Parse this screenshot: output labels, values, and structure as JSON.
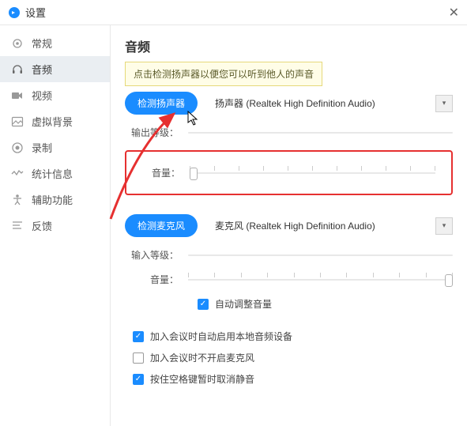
{
  "titlebar": {
    "title": "设置"
  },
  "sidebar": {
    "items": [
      {
        "label": "常规"
      },
      {
        "label": "音频"
      },
      {
        "label": "视频"
      },
      {
        "label": "虚拟背景"
      },
      {
        "label": "录制"
      },
      {
        "label": "统计信息"
      },
      {
        "label": "辅助功能"
      },
      {
        "label": "反馈"
      }
    ]
  },
  "page": {
    "title": "音频",
    "tooltip": "点击检测扬声器以便您可以听到他人的声音",
    "speaker": {
      "test_btn": "检测扬声器",
      "device": "扬声器 (Realtek High Definition Audio)",
      "output_level_label": "输出等级：",
      "volume_label": "音量："
    },
    "mic": {
      "test_btn": "检测麦克风",
      "device": "麦克风 (Realtek High Definition Audio)",
      "input_level_label": "输入等级：",
      "volume_label": "音量：",
      "auto_adjust": "自动调整音量"
    },
    "options": {
      "auto_enable_audio": "加入会议时自动启用本地音频设备",
      "join_without_mic": "加入会议时不开启麦克风",
      "space_unmute": "按住空格键暂时取消静音"
    }
  }
}
